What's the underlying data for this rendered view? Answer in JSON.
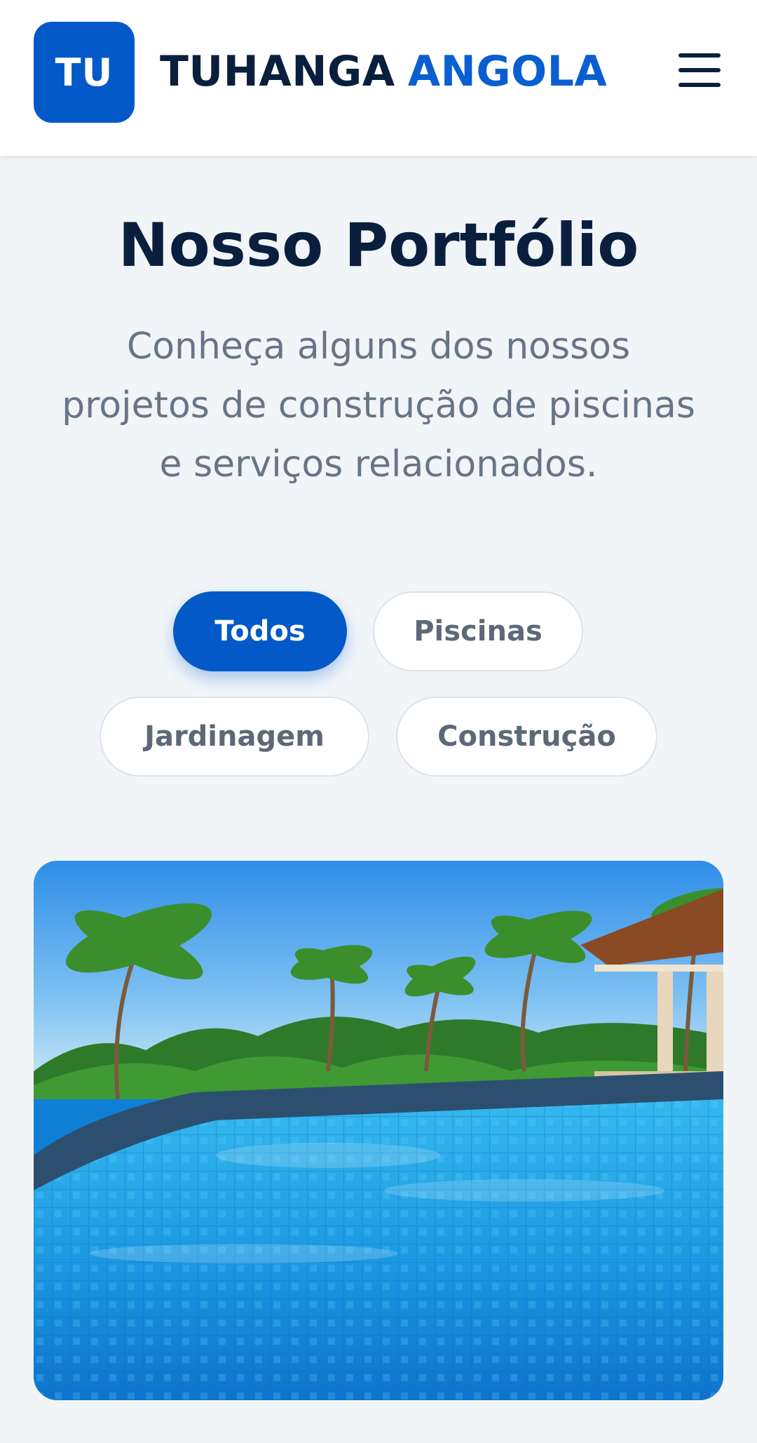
{
  "header": {
    "logo_initials": "TU",
    "brand_primary": "TUHANGA",
    "brand_accent": "ANGOLA",
    "menu_icon": "hamburger-menu-icon"
  },
  "hero": {
    "title": "Nosso Portfólio",
    "subtitle": "Conheça alguns dos nossos projetos de construção de piscinas e serviços relacionados."
  },
  "filters": [
    {
      "label": "Todos",
      "active": true
    },
    {
      "label": "Piscinas",
      "active": false
    },
    {
      "label": "Jardinagem",
      "active": false
    },
    {
      "label": "Construção",
      "active": false
    }
  ],
  "colors": {
    "brand_blue": "#0459c8",
    "dark_navy": "#0a1f3d",
    "muted_text": "#687587",
    "background": "#f1f5f8"
  },
  "portfolio": {
    "first_item_image": "tropical-infinity-pool-photo"
  }
}
